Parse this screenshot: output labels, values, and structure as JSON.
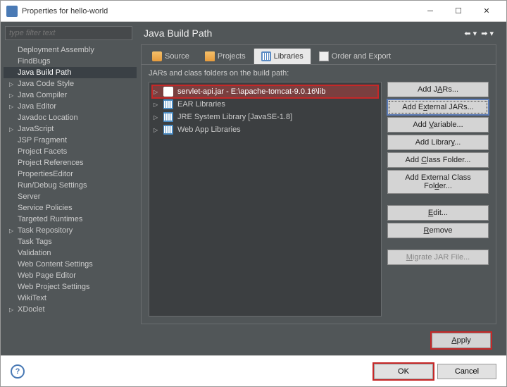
{
  "window": {
    "title": "Properties for hello-world"
  },
  "filter": {
    "placeholder": "type filter text"
  },
  "tree_items": [
    {
      "label": "Deployment Assembly",
      "child": false
    },
    {
      "label": "FindBugs",
      "child": false
    },
    {
      "label": "Java Build Path",
      "child": false,
      "selected": true
    },
    {
      "label": "Java Code Style",
      "child": true
    },
    {
      "label": "Java Compiler",
      "child": true
    },
    {
      "label": "Java Editor",
      "child": true
    },
    {
      "label": "Javadoc Location",
      "child": false
    },
    {
      "label": "JavaScript",
      "child": true
    },
    {
      "label": "JSP Fragment",
      "child": false
    },
    {
      "label": "Project Facets",
      "child": false
    },
    {
      "label": "Project References",
      "child": false
    },
    {
      "label": "PropertiesEditor",
      "child": false
    },
    {
      "label": "Run/Debug Settings",
      "child": false
    },
    {
      "label": "Server",
      "child": false
    },
    {
      "label": "Service Policies",
      "child": false
    },
    {
      "label": "Targeted Runtimes",
      "child": false
    },
    {
      "label": "Task Repository",
      "child": true
    },
    {
      "label": "Task Tags",
      "child": false
    },
    {
      "label": "Validation",
      "child": false
    },
    {
      "label": "Web Content Settings",
      "child": false
    },
    {
      "label": "Web Page Editor",
      "child": false
    },
    {
      "label": "Web Project Settings",
      "child": false
    },
    {
      "label": "WikiText",
      "child": false
    },
    {
      "label": "XDoclet",
      "child": true
    }
  ],
  "header": {
    "title": "Java Build Path"
  },
  "tabs": [
    {
      "label": "Source",
      "icon": "src"
    },
    {
      "label": "Projects",
      "icon": "prj"
    },
    {
      "label": "Libraries",
      "icon": "lib",
      "active": true
    },
    {
      "label": "Order and Export",
      "icon": "ord"
    }
  ],
  "build_path_label": "JARs and class folders on the build path:",
  "jar_entries": [
    {
      "label": "servlet-api.jar - E:\\apache-tomcat-9.0.16\\lib",
      "icon": "jar",
      "selected": true
    },
    {
      "label": "EAR Libraries",
      "icon": "lib"
    },
    {
      "label": "JRE System Library [JavaSE-1.8]",
      "icon": "lib"
    },
    {
      "label": "Web App Libraries",
      "icon": "lib"
    }
  ],
  "buttons": {
    "add_jars": "Add JARs...",
    "add_ext_jars": "Add External JARs...",
    "add_variable": "Add Variable...",
    "add_library": "Add Library...",
    "add_class_folder": "Add Class Folder...",
    "add_ext_class_folder": "Add External Class Folder...",
    "edit": "Edit...",
    "remove": "Remove",
    "migrate": "Migrate JAR File...",
    "apply": "Apply",
    "ok": "OK",
    "cancel": "Cancel"
  }
}
